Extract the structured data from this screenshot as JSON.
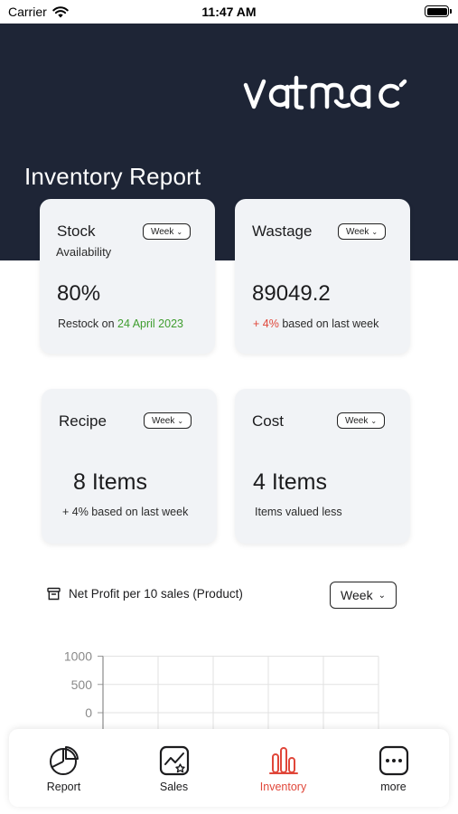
{
  "status_bar": {
    "carrier": "Carrier",
    "time": "11:47 AM"
  },
  "brand": {
    "logo_text": "vatmac"
  },
  "page": {
    "title": "Inventory Report"
  },
  "cards": {
    "stock": {
      "title": "Stock",
      "subtitle": "Availability",
      "period": "Week",
      "value": "80%",
      "note_prefix": "Restock on ",
      "note_highlight": "24 April 2023"
    },
    "wastage": {
      "title": "Wastage",
      "period": "Week",
      "value": "89049.2",
      "note_highlight": "+ 4%",
      "note_suffix": " based on last week"
    },
    "recipe": {
      "title": "Recipe",
      "period": "Week",
      "value": "8 Items",
      "note": "+ 4% based on last week"
    },
    "cost": {
      "title": "Cost",
      "period": "Week",
      "value": "4 Items",
      "note": "Items valued less"
    }
  },
  "chart_section": {
    "title": "Net Profit per 10 sales (Product)",
    "period": "Week"
  },
  "chart_data": {
    "type": "bar",
    "title": "Net Profit per 10 sales (Product)",
    "categories": [],
    "values": [],
    "ylim": [
      0,
      1000
    ],
    "y_ticks": [
      "1000",
      "500",
      "0"
    ],
    "grid": true
  },
  "tabs": [
    {
      "label": "Report",
      "icon": "pie-chart-icon",
      "active": false
    },
    {
      "label": "Sales",
      "icon": "sales-chart-icon",
      "active": false
    },
    {
      "label": "Inventory",
      "icon": "bar-chart-icon",
      "active": true
    },
    {
      "label": "more",
      "icon": "more-dots-icon",
      "active": false
    }
  ],
  "colors": {
    "header_bg": "#1e2536",
    "card_bg": "#f1f3f6",
    "accent_red": "#e0473a",
    "accent_green": "#3f9d2f"
  }
}
